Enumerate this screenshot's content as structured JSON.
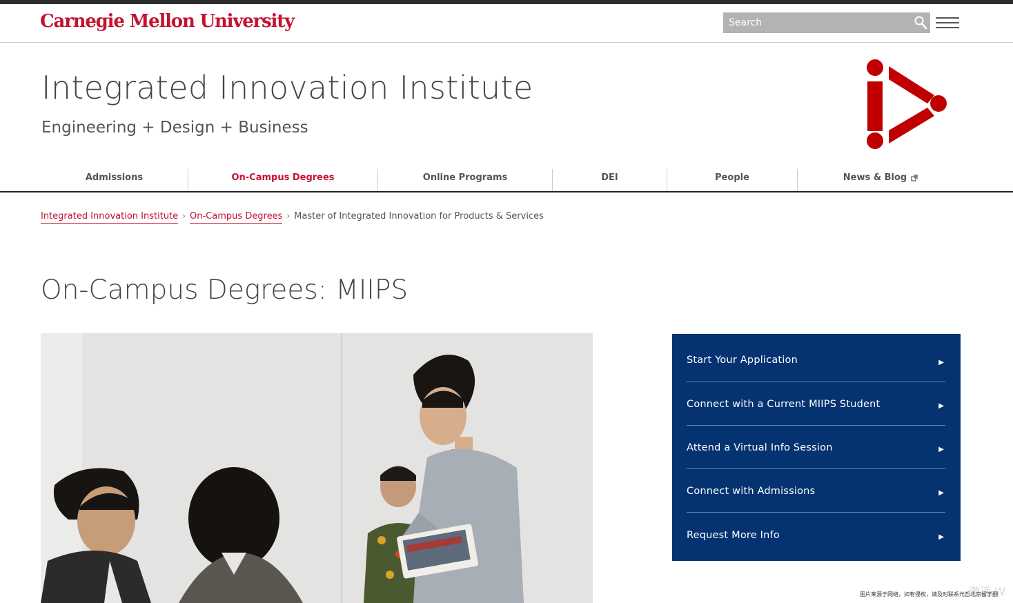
{
  "header": {
    "university_name": "Carnegie Mellon University",
    "search_placeholder": "Search",
    "brand_color": "#c41230"
  },
  "site": {
    "title": "Integrated Innovation Institute",
    "tagline": "Engineering + Design + Business"
  },
  "nav": {
    "items": [
      {
        "label": "Admissions"
      },
      {
        "label": "On-Campus Degrees",
        "active": true
      },
      {
        "label": "Online Programs"
      },
      {
        "label": "DEI"
      },
      {
        "label": "People"
      },
      {
        "label": "News & Blog",
        "icon": "external-link-icon"
      }
    ]
  },
  "breadcrumb": {
    "items": [
      {
        "label": "Integrated Innovation Institute"
      },
      {
        "label": "On-Campus Degrees"
      },
      {
        "label": "Master of Integrated Innovation for Products & Services"
      }
    ],
    "separator": "›"
  },
  "page": {
    "title": "On-Campus Degrees: MIIPS"
  },
  "cta": {
    "background": "#053371",
    "items": [
      {
        "label": "Start Your Application"
      },
      {
        "label": "Connect with a Current MIIPS Student"
      },
      {
        "label": "Attend a Virtual Info Session"
      },
      {
        "label": "Connect with Admissions"
      },
      {
        "label": "Request More Info"
      }
    ],
    "arrow": "▶"
  },
  "overlay": {
    "notice": "图片来源于网络，如有侵权，请及时联系元哲北京留学翻",
    "watermark": "激活 W"
  }
}
